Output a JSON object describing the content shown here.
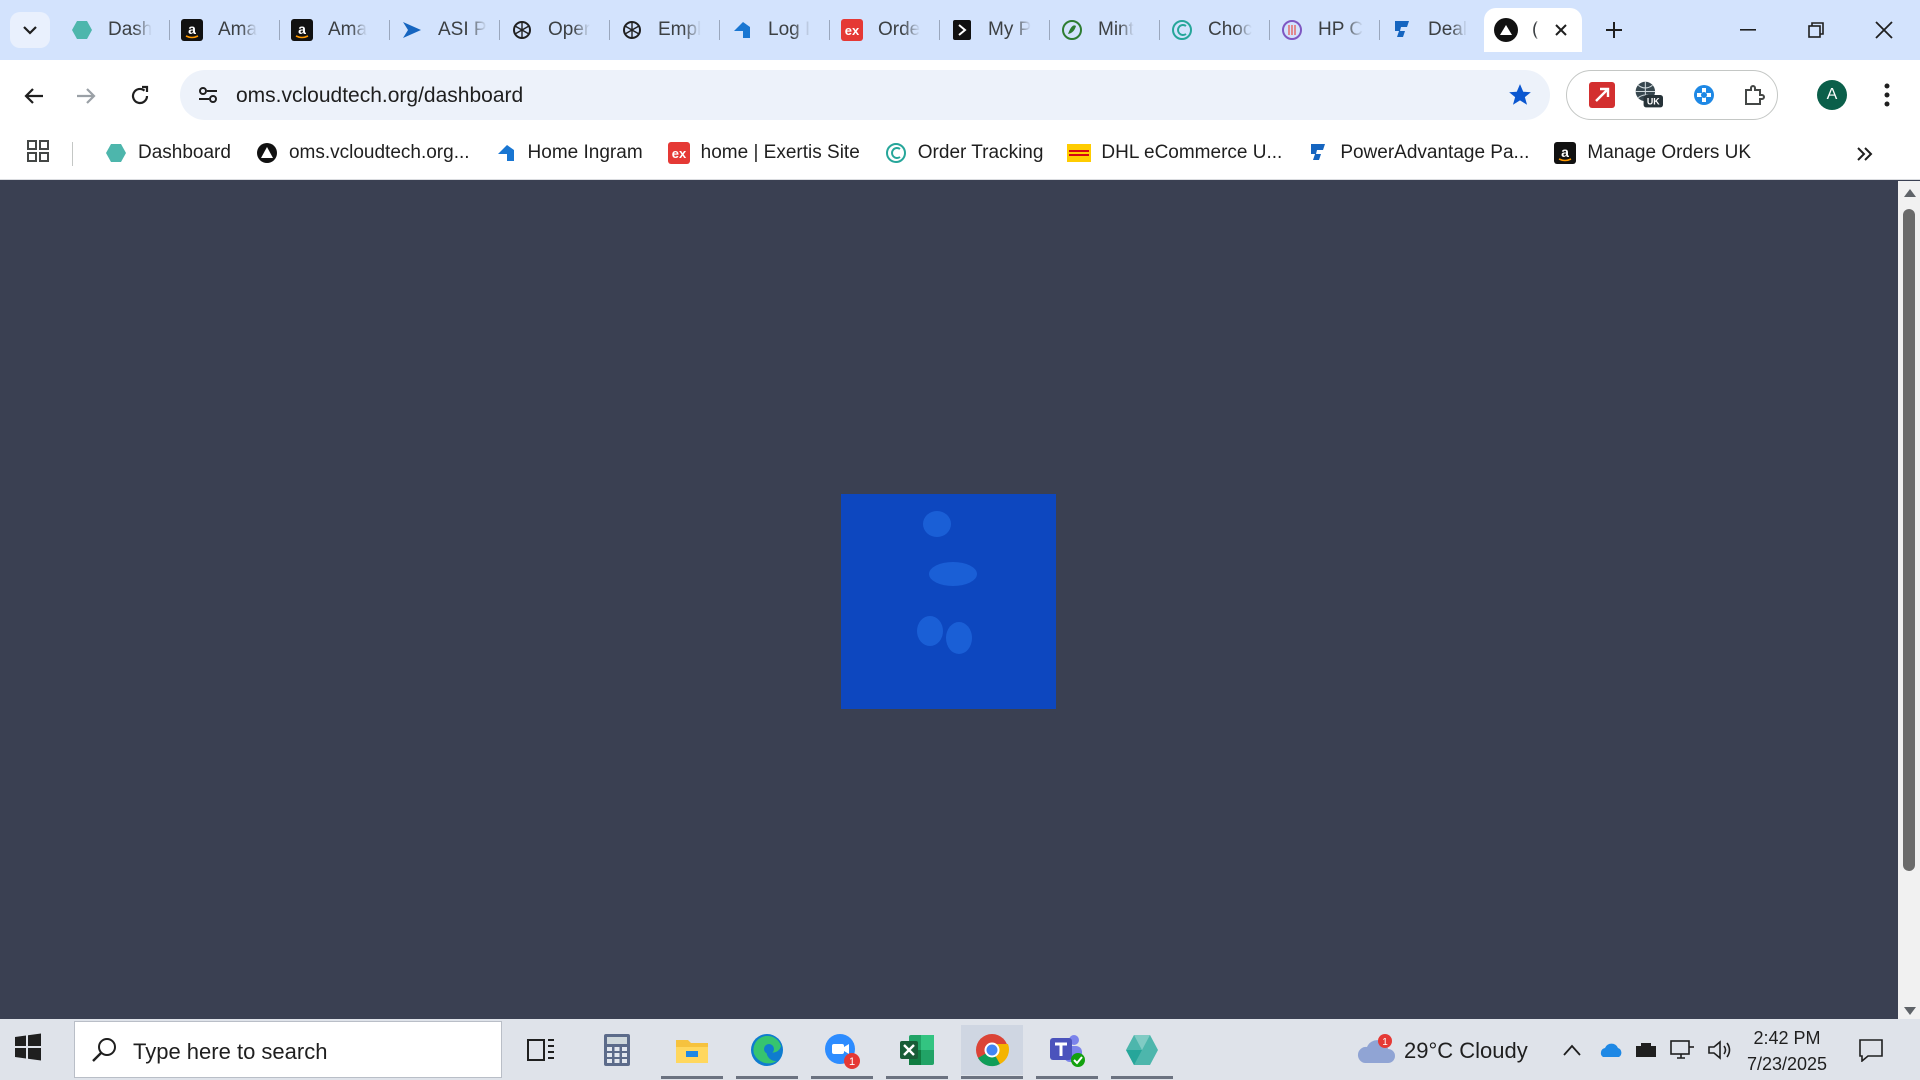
{
  "tabs": [
    {
      "title": "Dash",
      "icon": "hexagon-icon",
      "color": "#4db6ac"
    },
    {
      "title": "Ama",
      "icon": "amazon-icon",
      "color": "#111111"
    },
    {
      "title": "Ama",
      "icon": "amazon-icon",
      "color": "#111111"
    },
    {
      "title": "ASI P",
      "icon": "arrow-play-icon",
      "color": "#1565c0"
    },
    {
      "title": "Oper",
      "icon": "openai-icon",
      "color": "#202020"
    },
    {
      "title": "Empl",
      "icon": "openai-icon",
      "color": "#202020"
    },
    {
      "title": "Log I",
      "icon": "ingram-icon",
      "color": "#1976d2"
    },
    {
      "title": "Orde",
      "icon": "exertis-icon",
      "color": "#e53935"
    },
    {
      "title": "My P",
      "icon": "document-icon",
      "color": "#111111"
    },
    {
      "title": "Mint",
      "icon": "mint-icon",
      "color": "#2e7d32"
    },
    {
      "title": "Choc",
      "icon": "c-logo-icon",
      "color": "#26a69a"
    },
    {
      "title": "HP C",
      "icon": "hp-icon",
      "color": "#7e57c2"
    },
    {
      "title": "Deal",
      "icon": "power-icon",
      "color": "#1565c0"
    }
  ],
  "active_tab": {
    "title": "(",
    "icon": "triangle-logo-icon"
  },
  "address_bar": {
    "url": "oms.vcloudtech.org/dashboard"
  },
  "extensions": [
    {
      "name": "pdf-icon",
      "color": "#d32f2f"
    },
    {
      "name": "vpn-uk-icon",
      "badge": "UK",
      "color": "#37474f"
    },
    {
      "name": "extension-cross-icon",
      "color": "#1e88e5"
    },
    {
      "name": "puzzle-icon",
      "color": "#444746"
    }
  ],
  "profile": {
    "initial": "A",
    "color": "#0b5f4a"
  },
  "bookmarks": [
    {
      "label": "Dashboard",
      "icon": "hexagon-icon",
      "color": "#4db6ac"
    },
    {
      "label": "oms.vcloudtech.org...",
      "icon": "triangle-logo-icon",
      "color": "#111111"
    },
    {
      "label": "Home Ingram",
      "icon": "ingram-icon",
      "color": "#1976d2"
    },
    {
      "label": "home | Exertis Site",
      "icon": "exertis-icon",
      "color": "#e53935"
    },
    {
      "label": "Order Tracking",
      "icon": "c-logo-icon",
      "color": "#26a69a"
    },
    {
      "label": "DHL eCommerce U...",
      "icon": "dhl-icon",
      "color": "#ffcc00"
    },
    {
      "label": "PowerAdvantage Pa...",
      "icon": "power-icon",
      "color": "#1565c0"
    },
    {
      "label": "Manage Orders UK",
      "icon": "amazon-icon",
      "color": "#111111"
    }
  ],
  "page": {
    "background": "#3a4052",
    "loader_color": "#0d47bf"
  },
  "taskbar": {
    "search_placeholder": "Type here to search",
    "weather": {
      "temp": "29°C",
      "condition": "Cloudy",
      "alert_count": "1"
    },
    "clock": {
      "time": "2:42 PM",
      "date": "7/23/2025"
    },
    "zoom_badge": "1"
  }
}
